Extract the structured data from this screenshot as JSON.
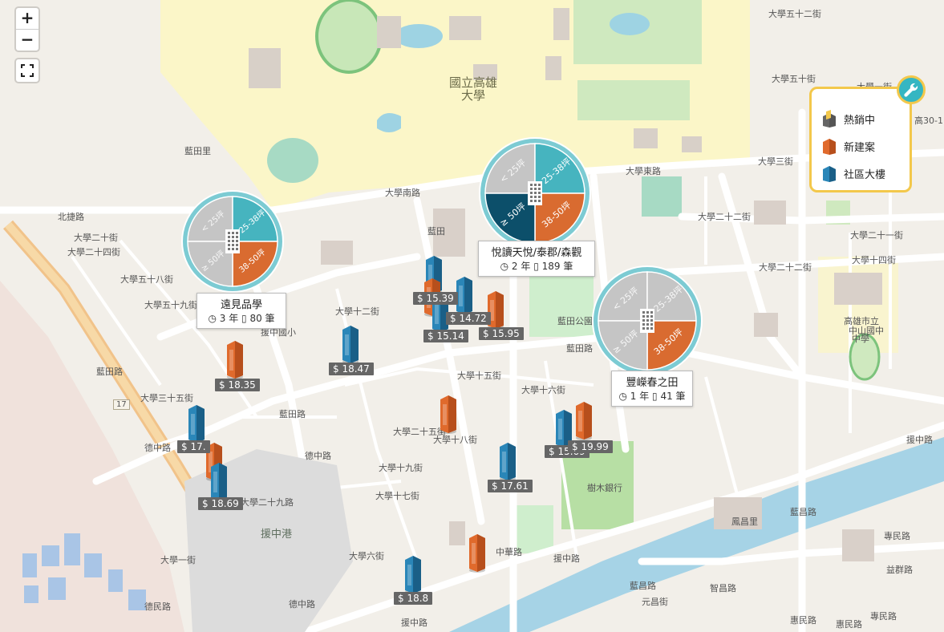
{
  "colors": {
    "tier_small": "#c5c5c5",
    "tier_mid": "#46b4bf",
    "tier_large": "#d96b30",
    "tier_xl": "#0c4f6a",
    "ring": "#7ccbd3",
    "price_bg": "#666666",
    "legend_border": "#f3c84b",
    "tower_blue": "#2a86b8",
    "tower_orange": "#e06a2c"
  },
  "controls": {
    "zoom_in": "+",
    "zoom_out": "−"
  },
  "map_labels": [
    {
      "text": "國立高雄",
      "style": "big"
    },
    {
      "text": "大學",
      "style": "big"
    },
    {
      "text": "大學南路"
    },
    {
      "text": "大學東路"
    },
    {
      "text": "北捷路"
    },
    {
      "text": "大學二十二街"
    },
    {
      "text": "大學五十二街"
    },
    {
      "text": "大學五十街"
    },
    {
      "text": "大學三街"
    },
    {
      "text": "大學二十二街"
    },
    {
      "text": "大學二十一街"
    },
    {
      "text": "大學十四街"
    },
    {
      "text": "大學五十八街"
    },
    {
      "text": "大學五十九街"
    },
    {
      "text": "大學十二街"
    },
    {
      "text": "大學二十街"
    },
    {
      "text": "大學十六街"
    },
    {
      "text": "大學十八街"
    },
    {
      "text": "大學二十五街"
    },
    {
      "text": "大學十五街"
    },
    {
      "text": "大學三十五街"
    },
    {
      "text": "藍田"
    },
    {
      "text": "藍田路"
    },
    {
      "text": "藍田路"
    },
    {
      "text": "藍田公園"
    },
    {
      "text": "德中路"
    },
    {
      "text": "德中路"
    },
    {
      "text": "德中路"
    },
    {
      "text": "援中路"
    },
    {
      "text": "援中路"
    },
    {
      "text": "援中港",
      "style": "mid"
    },
    {
      "text": "援中國小"
    },
    {
      "text": "樹木銀行"
    },
    {
      "text": "高雄市立"
    },
    {
      "text": "中山國中"
    },
    {
      "text": "中學"
    },
    {
      "text": "援中路"
    },
    {
      "text": "藍昌路"
    },
    {
      "text": "藍昌路"
    },
    {
      "text": "專民路"
    },
    {
      "text": "專民路"
    },
    {
      "text": "益群路"
    },
    {
      "text": "元昌街"
    },
    {
      "text": "智昌路"
    },
    {
      "text": "惠民路"
    },
    {
      "text": "惠民路"
    },
    {
      "text": "藍田里"
    },
    {
      "text": "藍田路"
    },
    {
      "text": "大學六街"
    },
    {
      "text": "大學一街"
    },
    {
      "text": "大學十七街"
    },
    {
      "text": "大學二十九路"
    },
    {
      "text": "大學十九街"
    },
    {
      "text": "中華路"
    },
    {
      "text": "鳳昌里"
    },
    {
      "text": "德民路"
    },
    {
      "text": "高30-1"
    },
    {
      "text": "大學一街"
    },
    {
      "text": "大學二十四街"
    },
    {
      "text": "17"
    }
  ],
  "clusters": [
    {
      "name": "遠見品學",
      "years": "3 年",
      "count": "80 筆",
      "sectors": [
        {
          "label": "< 25坪",
          "tier": "tier_small"
        },
        {
          "label": "25-38坪",
          "tier": "tier_mid"
        },
        {
          "label": "38-50坪",
          "tier": "tier_large"
        },
        {
          "label": "≥ 50坪",
          "tier": "tier_small"
        }
      ]
    },
    {
      "name": "悅讀天悅/泰郡/森觀",
      "years": "2 年",
      "count": "189 筆",
      "sectors": [
        {
          "label": "< 25坪",
          "tier": "tier_small"
        },
        {
          "label": "25-38坪",
          "tier": "tier_mid"
        },
        {
          "label": "38-50坪",
          "tier": "tier_large"
        },
        {
          "label": "≥ 50坪",
          "tier": "tier_xl"
        }
      ]
    },
    {
      "name": "豐嶸春之田",
      "years": "1 年",
      "count": "41 筆",
      "sectors": [
        {
          "label": "< 25坪",
          "tier": "tier_small"
        },
        {
          "label": "25-38坪",
          "tier": "tier_small"
        },
        {
          "label": "38-50坪",
          "tier": "tier_large"
        },
        {
          "label": "≥ 50坪",
          "tier": "tier_small"
        }
      ]
    }
  ],
  "markers": [
    {
      "type": "blue",
      "price": ""
    },
    {
      "type": "orange",
      "price": "$ 15.39"
    },
    {
      "type": "blue",
      "price": "$ 14.72"
    },
    {
      "type": "blue",
      "price": "$ 15.14"
    },
    {
      "type": "orange",
      "price": "$ 15.95"
    },
    {
      "type": "blue",
      "price": "$ 18.47"
    },
    {
      "type": "orange",
      "price": "$ 18.35"
    },
    {
      "type": "blue",
      "price": "$ 17."
    },
    {
      "type": "orange",
      "price": ""
    },
    {
      "type": "blue",
      "price": "$ 18.69"
    },
    {
      "type": "orange",
      "price": ""
    },
    {
      "type": "blue",
      "price": "$ 17.61"
    },
    {
      "type": "blue",
      "price": "$ 15.69"
    },
    {
      "type": "orange",
      "price": "$ 19.99"
    },
    {
      "type": "orange",
      "price": ""
    },
    {
      "type": "blue",
      "price": "$ 18.8"
    }
  ],
  "legend": {
    "items": [
      {
        "label": "熱銷中",
        "icon": "hot-selling-icon"
      },
      {
        "label": "新建案",
        "icon": "new-project-icon"
      },
      {
        "label": "社區大樓",
        "icon": "community-building-icon"
      }
    ]
  }
}
